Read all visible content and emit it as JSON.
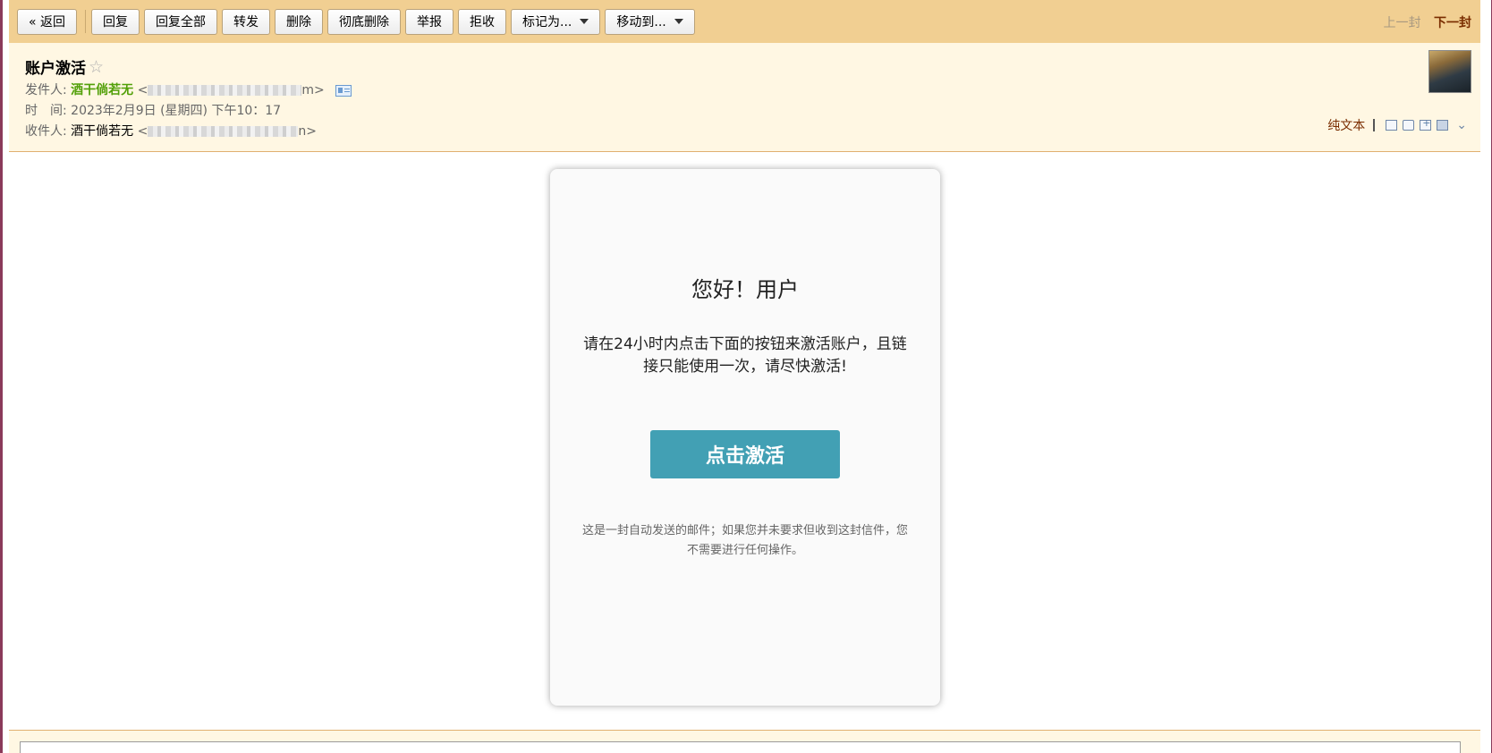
{
  "toolbar": {
    "back_label": "« 返回",
    "buttons": [
      "回复",
      "回复全部",
      "转发",
      "删除",
      "彻底删除",
      "举报",
      "拒收"
    ],
    "mark_label": "标记为...",
    "move_label": "移动到...",
    "prev_label": "上一封",
    "next_label": "下一封"
  },
  "header": {
    "subject": "账户激活",
    "star_icon": "☆",
    "from_label": "发件人:",
    "from_name": "酒干倘若无",
    "from_addr_open": "<",
    "from_addr_close": "m>",
    "time_label": "时　间:",
    "time_value": "2023年2月9日 (星期四) 下午10：17",
    "to_label": "收件人:",
    "to_name": "酒干倘若无",
    "to_addr_open": "<",
    "to_addr_close": "n>",
    "plain_text_label": "纯文本"
  },
  "email": {
    "greeting": "您好！用户",
    "message": "请在24小时内点击下面的按钮来激活账户，且链接只能使用一次，请尽快激活!",
    "button_label": "点击激活",
    "note": "这是一封自动发送的邮件；如果您并未要求但收到这封信件，您不需要进行任何操作。",
    "button_color": "#42a0b4"
  }
}
